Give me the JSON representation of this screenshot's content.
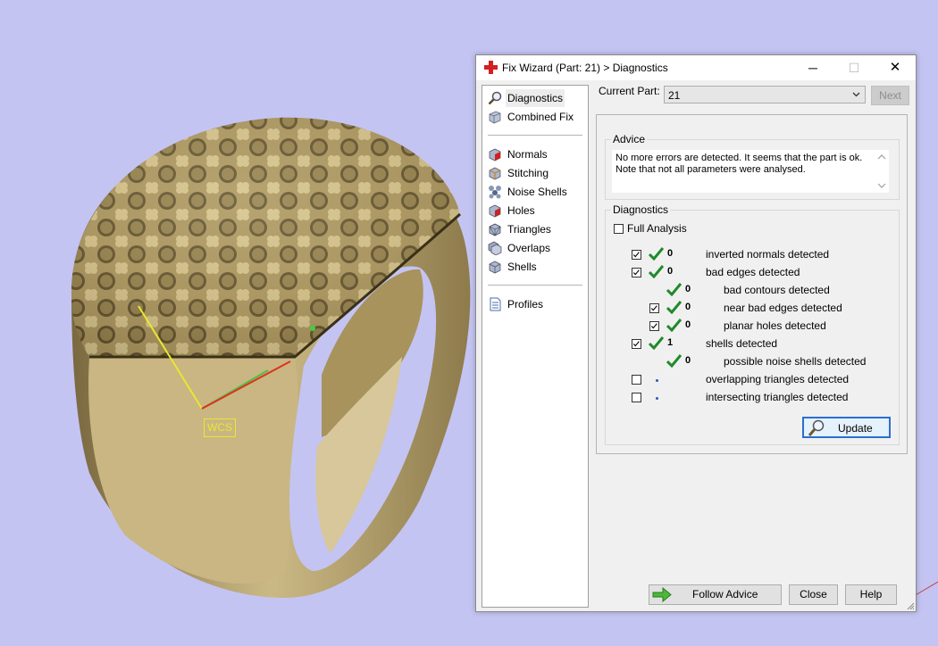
{
  "viewport": {
    "wcs_label": "WCS"
  },
  "dialog": {
    "title": "Fix Wizard (Part: 21) > Diagnostics",
    "window_buttons": {
      "minimize": "─",
      "maximize": "☐",
      "close": "✕"
    }
  },
  "nav": {
    "group1": [
      {
        "label": "Diagnostics",
        "icon": "magnifier-icon",
        "selected": true
      },
      {
        "label": "Combined Fix",
        "icon": "combined-fix-icon"
      }
    ],
    "group2": [
      {
        "label": "Normals",
        "icon": "normals-icon"
      },
      {
        "label": "Stitching",
        "icon": "stitching-icon"
      },
      {
        "label": "Noise Shells",
        "icon": "noise-shells-icon"
      },
      {
        "label": "Holes",
        "icon": "holes-icon"
      },
      {
        "label": "Triangles",
        "icon": "triangles-icon"
      },
      {
        "label": "Overlaps",
        "icon": "overlaps-icon"
      },
      {
        "label": "Shells",
        "icon": "shells-icon"
      }
    ],
    "group3": [
      {
        "label": "Profiles",
        "icon": "profiles-icon"
      }
    ]
  },
  "current_part": {
    "label": "Current Part:",
    "value": "21",
    "next_label": "Next"
  },
  "advice": {
    "title": "Advice",
    "line1": "No more errors are detected. It seems that the part is ok.",
    "line2": "Note that not all parameters were analysed."
  },
  "diagnostics": {
    "title": "Diagnostics",
    "full_analysis_label": "Full Analysis",
    "rows": [
      {
        "checkbox": true,
        "checked": true,
        "status": "ok",
        "count": "0",
        "label": "inverted normals detected"
      },
      {
        "checkbox": true,
        "checked": true,
        "status": "ok",
        "count": "0",
        "label": "bad edges detected"
      },
      {
        "checkbox": false,
        "status": "ok",
        "count": "0",
        "label": "bad contours detected"
      },
      {
        "checkbox": true,
        "checked": true,
        "status": "ok",
        "count": "0",
        "label": "near bad edges detected"
      },
      {
        "checkbox": true,
        "checked": true,
        "status": "ok",
        "count": "0",
        "label": "planar holes detected"
      },
      {
        "checkbox": true,
        "checked": true,
        "status": "ok",
        "count": "1",
        "label": "shells detected"
      },
      {
        "checkbox": false,
        "status": "ok",
        "count": "0",
        "label": "possible noise shells detected"
      },
      {
        "checkbox": true,
        "checked": false,
        "status": "pending",
        "count": "",
        "label": "overlapping triangles detected"
      },
      {
        "checkbox": true,
        "checked": false,
        "status": "pending",
        "count": "",
        "label": "intersecting triangles detected"
      }
    ],
    "update_label": "Update"
  },
  "footer": {
    "follow_advice_label": "Follow Advice",
    "close_label": "Close",
    "help_label": "Help"
  },
  "colors": {
    "background": "#c4c4f3",
    "ring_gold": "#b9a46e",
    "tick_green": "#1f8a2a",
    "accent_red": "#d42020"
  }
}
